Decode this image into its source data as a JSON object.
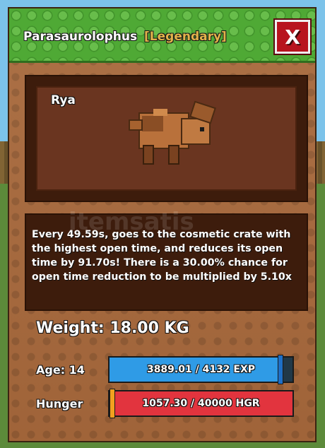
{
  "header": {
    "pet_species": "Parasaurolophus",
    "rarity": "[Legendary]",
    "close_label": "X"
  },
  "showcase": {
    "pet_name": "Rya",
    "pet_icon": "parasaurolophus-pet-icon"
  },
  "description": {
    "text": "Every 49.59s, goes to the cosmetic crate with the highest open time, and reduces its open time by 91.70s! There is a 30.00% chance for open time reduction to be multiplied by 5.10x",
    "watermark": "itemsatis"
  },
  "stats": {
    "weight_text": "Weight: 18.00 KG",
    "age_label": "Age: 14",
    "exp_text": "3889.01 / 4132 EXP",
    "exp_fraction": 0.941,
    "hunger_label": "Hunger",
    "hunger_text": "1057.30 / 40000 HGR",
    "hunger_fraction": 0.026
  },
  "colors": {
    "exp_bar": "#2f9be6",
    "exp_marker": "#1e6fc7",
    "hunger_bar": "#e2343e",
    "hunger_marker": "#f2a01f",
    "rarity": "#e2b24a",
    "close_button": "#b8141e"
  }
}
